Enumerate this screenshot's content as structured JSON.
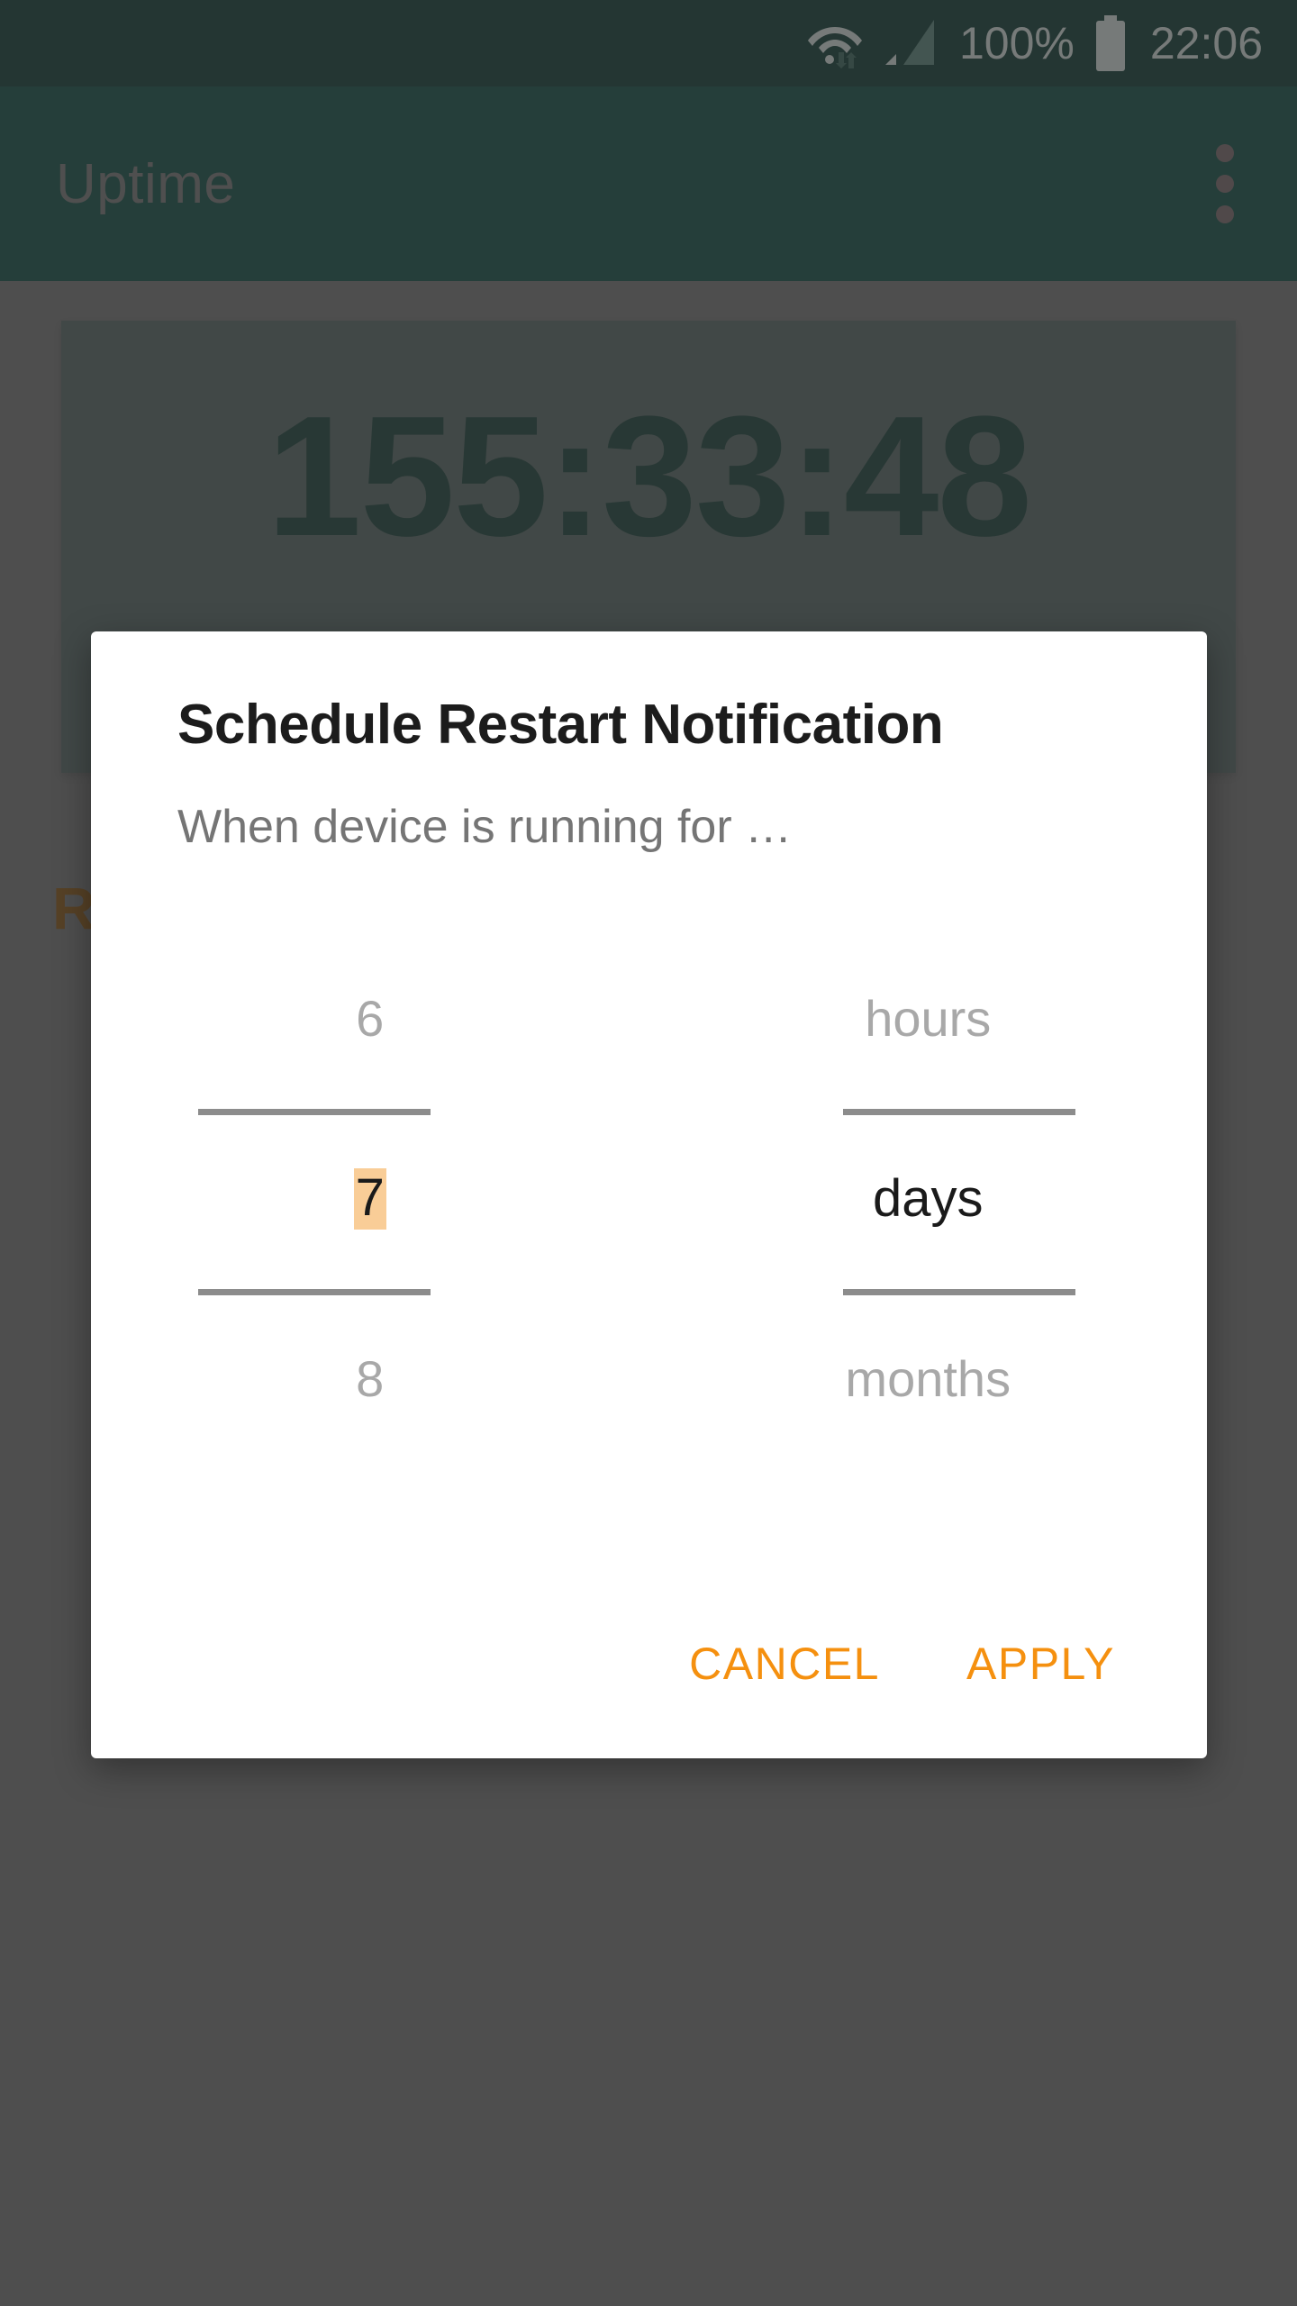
{
  "status_bar": {
    "wifi_icon": "wifi-with-data-arrows-icon",
    "signal_icon": "cellular-signal-icon",
    "battery_percent": "100%",
    "battery_icon": "battery-full-icon",
    "clock": "22:06",
    "background_color": "#022e27",
    "text_color": "#ced8d5"
  },
  "app_bar": {
    "title": "Uptime",
    "overflow_icon": "overflow-menu-icon",
    "background_color": "#034339"
  },
  "main": {
    "uptime_value": "155:33:48",
    "uptime_card_color": "#4a5a57",
    "uptime_text_color": "#0c342c",
    "restart_label_partial": "R"
  },
  "dialog": {
    "title": "Schedule Restart Notification",
    "subtitle": "When device is running for …",
    "accent_color": "#f5900f",
    "selection_highlight_color": "#f9cd97",
    "number_picker": {
      "name": "amount-picker",
      "previous": "6",
      "selected": "7",
      "next": "8"
    },
    "unit_picker": {
      "name": "unit-picker",
      "previous": "hours",
      "selected": "days",
      "next": "months"
    },
    "actions": {
      "cancel_label": "CANCEL",
      "apply_label": "APPLY"
    }
  }
}
